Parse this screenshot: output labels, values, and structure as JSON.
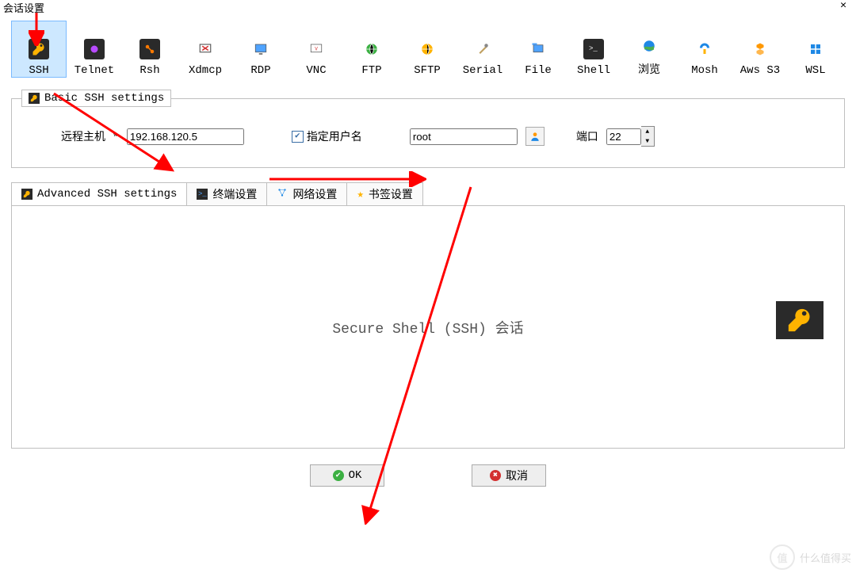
{
  "title": "会话设置",
  "protocols": [
    {
      "id": "ssh",
      "label": "SSH"
    },
    {
      "id": "telnet",
      "label": "Telnet"
    },
    {
      "id": "rsh",
      "label": "Rsh"
    },
    {
      "id": "xdmcp",
      "label": "Xdmcp"
    },
    {
      "id": "rdp",
      "label": "RDP"
    },
    {
      "id": "vnc",
      "label": "VNC"
    },
    {
      "id": "ftp",
      "label": "FTP"
    },
    {
      "id": "sftp",
      "label": "SFTP"
    },
    {
      "id": "serial",
      "label": "Serial"
    },
    {
      "id": "file",
      "label": "File"
    },
    {
      "id": "shell",
      "label": "Shell"
    },
    {
      "id": "browse",
      "label": "浏览"
    },
    {
      "id": "mosh",
      "label": "Mosh"
    },
    {
      "id": "awss3",
      "label": "Aws S3"
    },
    {
      "id": "wsl",
      "label": "WSL"
    }
  ],
  "basic": {
    "legend": "Basic SSH settings",
    "remote_host_label": "远程主机 *",
    "remote_host_value": "192.168.120.5",
    "specify_user_label": "指定用户名",
    "specify_user_checked": true,
    "username_value": "root",
    "port_label": "端口",
    "port_value": "22"
  },
  "tabs": {
    "advanced": "Advanced SSH settings",
    "terminal": "终端设置",
    "network": "网络设置",
    "bookmark": "书签设置"
  },
  "body_text": "Secure Shell (SSH) 会话",
  "buttons": {
    "ok": "OK",
    "cancel": "取消"
  },
  "watermark": {
    "icon": "值",
    "text": "什么值得买"
  }
}
